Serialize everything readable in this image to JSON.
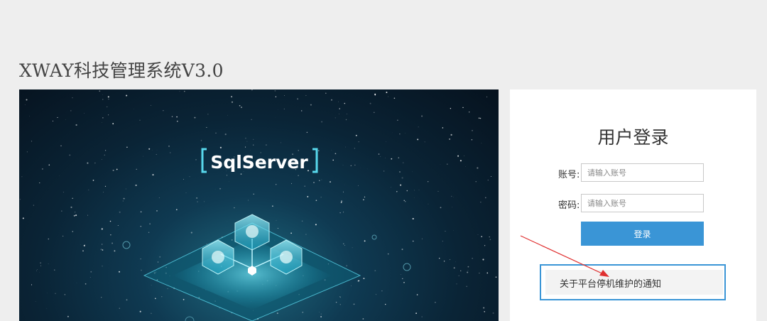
{
  "header": {
    "title": "XWAY科技管理系统V3.0"
  },
  "banner": {
    "text": "SqlServer"
  },
  "login": {
    "title": "用户登录",
    "account_label": "账号:",
    "account_placeholder": "请输入账号",
    "password_label": "密码:",
    "password_placeholder": "请输入账号",
    "submit_label": "登录"
  },
  "notice": {
    "text": "关于平台停机维护的通知"
  },
  "colors": {
    "accent": "#3a95d6",
    "annotation_arrow": "#e03030",
    "background": "#eeeeee"
  }
}
